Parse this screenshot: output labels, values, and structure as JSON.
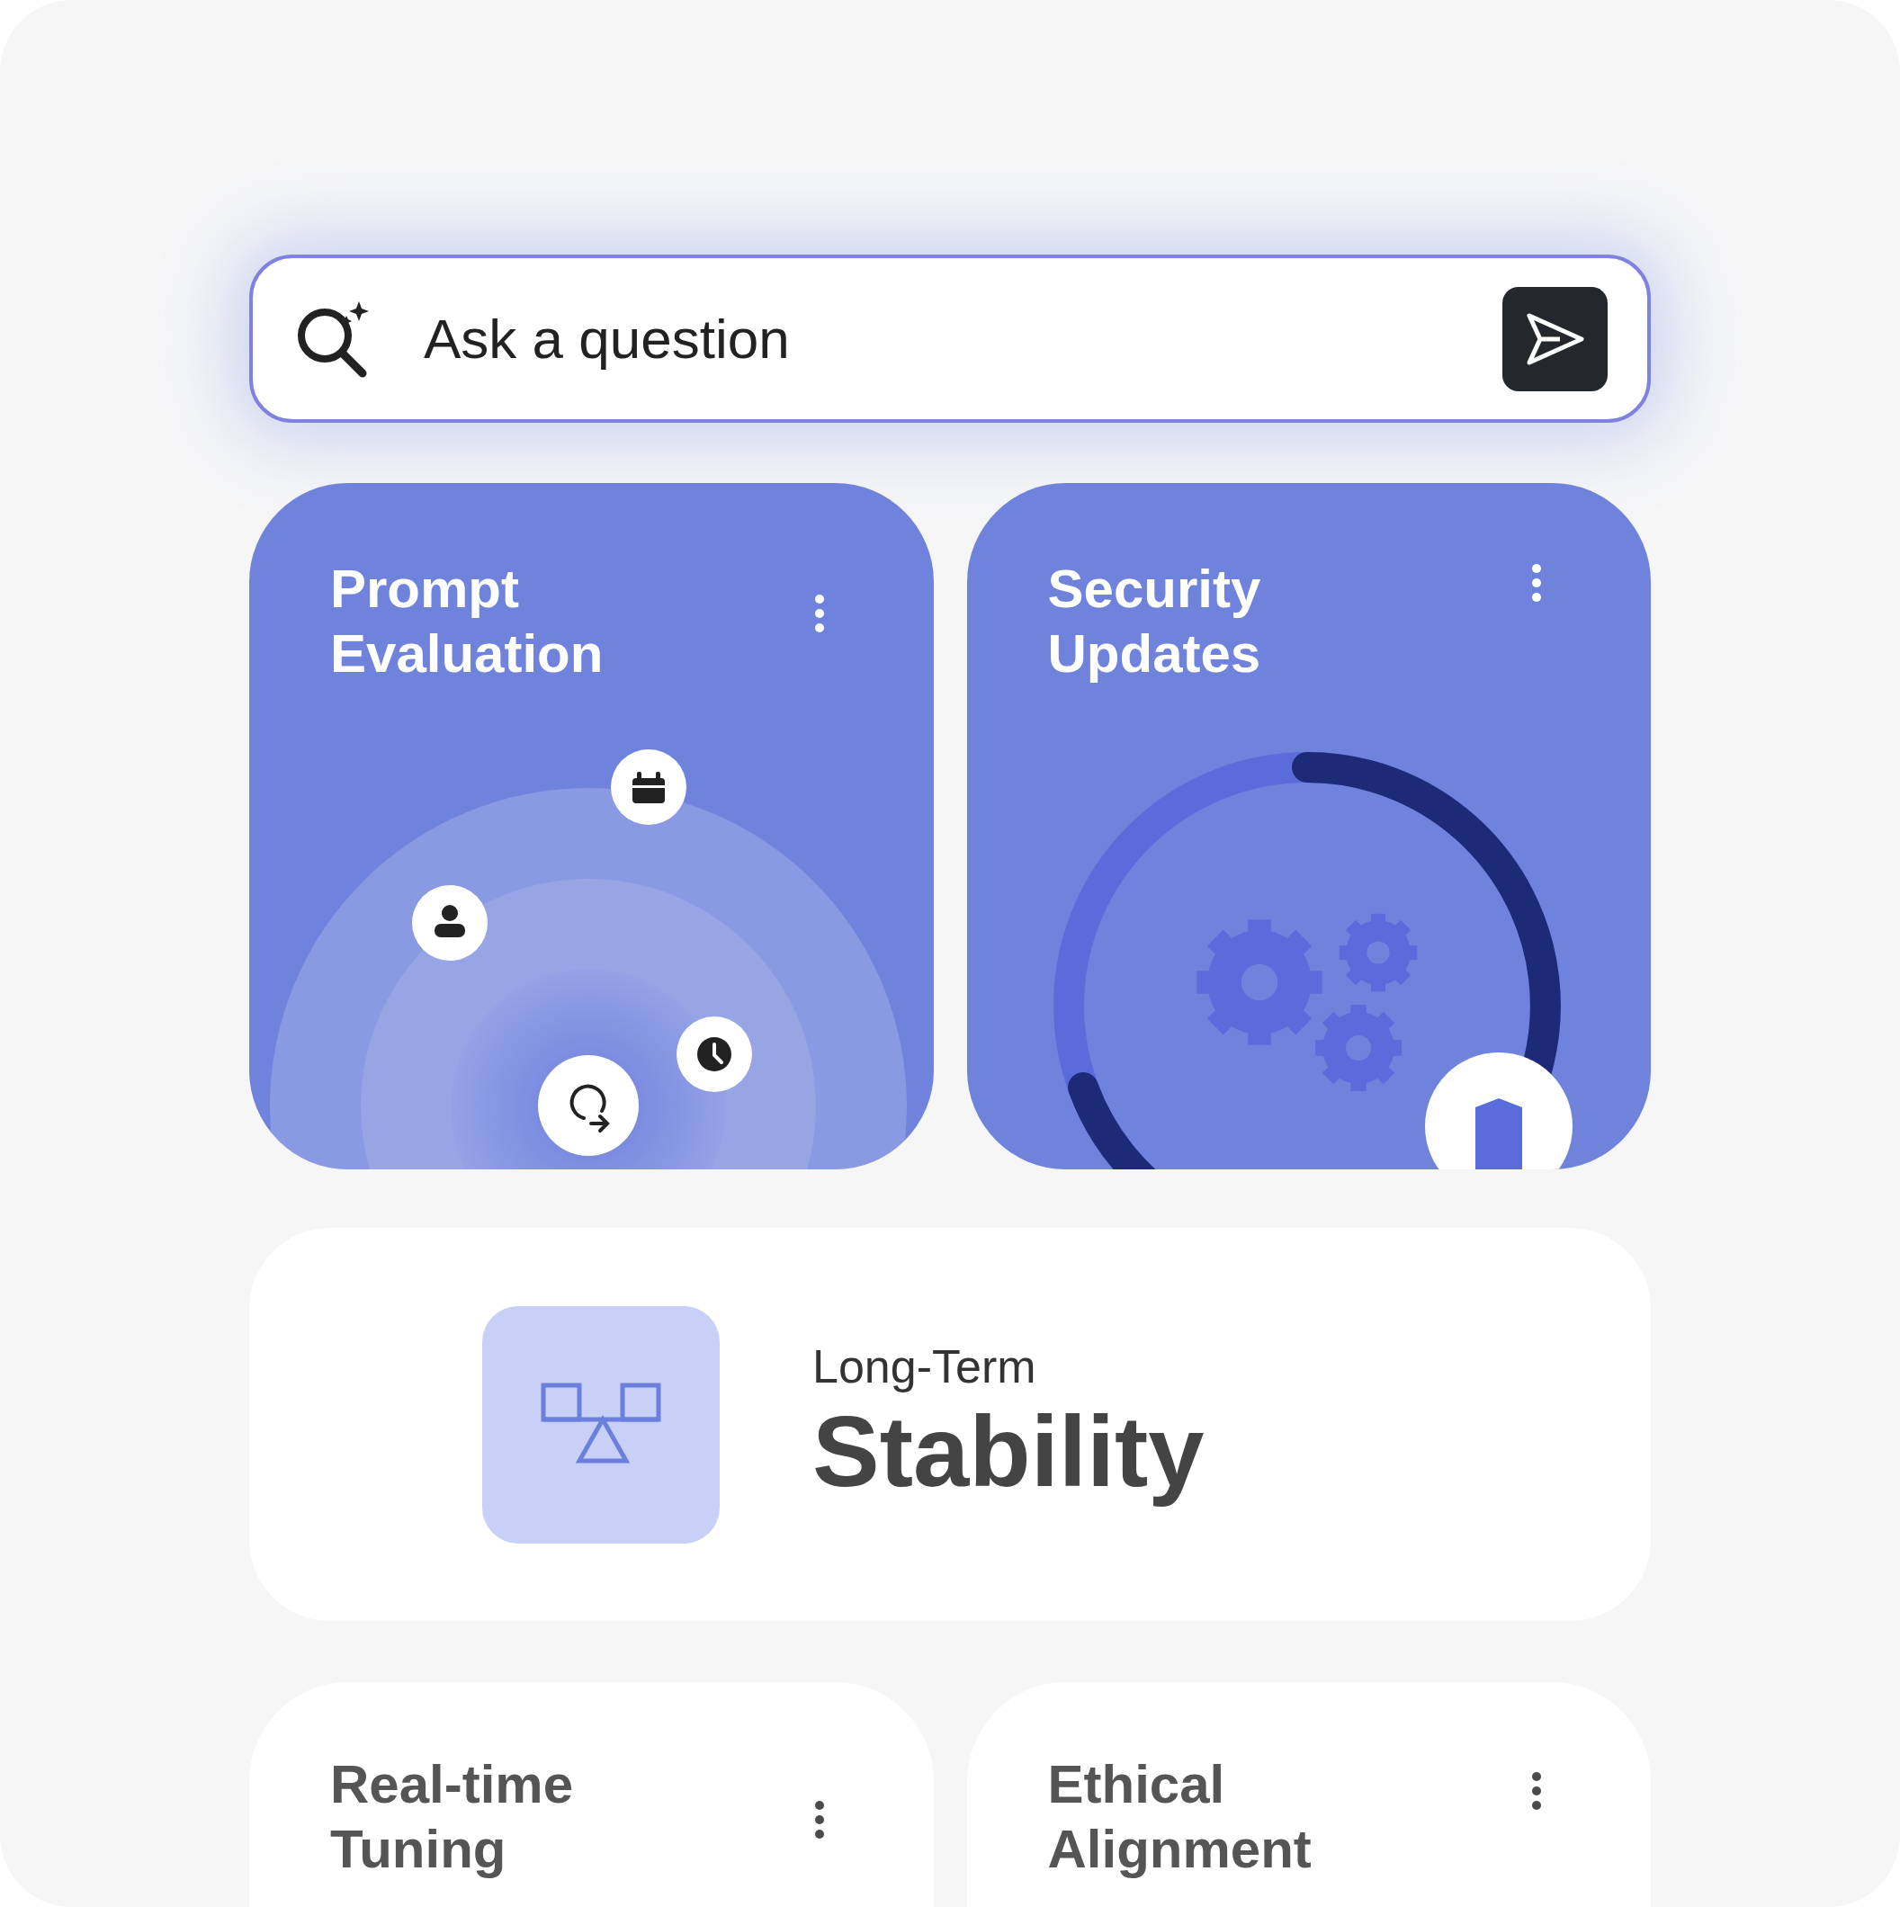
{
  "search": {
    "placeholder": "Ask a question"
  },
  "cards": [
    {
      "title": "Prompt Evaluation",
      "kind": "orbit"
    },
    {
      "title": "Security Updates",
      "kind": "gauge"
    }
  ],
  "feature": {
    "subtitle": "Long-Term",
    "title": "Stability"
  },
  "bottom_cards": [
    {
      "title": "Real-time Tuning"
    },
    {
      "title": "Ethical Alignment"
    }
  ]
}
